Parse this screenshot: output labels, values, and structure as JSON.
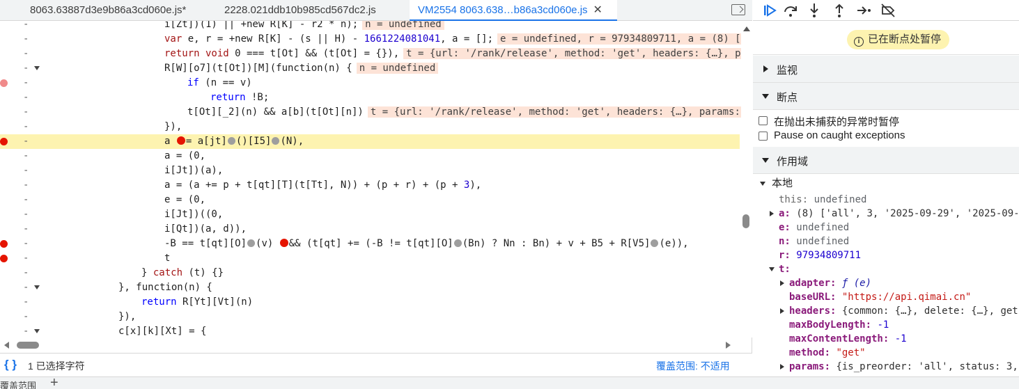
{
  "tabs": [
    {
      "label": "8063.63887d3e9b86a3cd060e.js*",
      "active": false
    },
    {
      "label": "2228.021ddb10b985cd567dc2.js",
      "active": false
    },
    {
      "label": "VM2554 8063.638…b86a3cd060e.js",
      "active": true
    }
  ],
  "code": {
    "dash": "-",
    "l1": "i[Zt])(1) || +new R[K] - r2 * n);",
    "l1_val": "n = undefined",
    "l2_kw": "var",
    "l2_a": " e, r = +new R[K] - (s || H) - ",
    "l2_num": "1661224081041",
    "l2_b": ", a = [];",
    "l2_val": "e = undefined, r = 97934809711, a = (8) ['",
    "l3_kw": "return void",
    "l3_a": " 0 === t[Ot] && (t[Ot] = {}),",
    "l3_val": "t = {url: '/rank/release', method: 'get', headers: {…}, pa",
    "l4": "R[W][o7](t[Ot])[M](function(n) {",
    "l4_val": "n = undefined",
    "l5_kw": "if",
    "l5": " (n == v)",
    "l6_kw": "return",
    "l6": " !B;",
    "l7": "t[Ot][_2](n) && a[b](t[Ot][n])",
    "l7_val": "t = {url: '/rank/release', method: 'get', headers: {…}, params:",
    "l8": "}),",
    "l9_a": "a ",
    "l9_b": "= a[jt]",
    "l9_c": "()[I5]",
    "l9_d": "(N),",
    "l10": "a = (0,",
    "l11": "i[Jt])(a),",
    "l12_a": "a = (a += p + t[qt][T](t[Tt], N)) + (p + r) + (p + ",
    "l12_num": "3",
    "l12_b": "),",
    "l13": "e = (0,",
    "l14": "i[Jt])((0,",
    "l15": "i[Qt])(a, d)),",
    "l16_a": "-B == t[qt][O]",
    "l16_b": "(v) ",
    "l16_c": "&& (t[qt] += (-B != t[qt][O]",
    "l16_d": "(Bn) ? Nn : Bn) + v + B5 + R[V5]",
    "l16_e": "(e)),",
    "l17": "t",
    "l18_a": "} ",
    "l18_kw": "catch",
    "l18_b": " (t) {}",
    "l19": "}, function(n) {",
    "l20_kw": "return",
    "l20": " R[Yt][Vt](n)",
    "l21": "}),",
    "l22": "c[x][k][Xt] = {"
  },
  "status": {
    "braces": "{ }",
    "selection": "1 已选择字符",
    "coverage": "覆盖范围: 不适用"
  },
  "bottom": {
    "label": "覆盖范围",
    "plus": "+"
  },
  "debugger": {
    "paused": "已在断点处暂停",
    "sections": {
      "watch": "监视",
      "breakpoints": "断点",
      "scope": "作用域"
    },
    "pause_uncaught": "在抛出未捕获的异常时暂停",
    "pause_caught": "Pause on caught exceptions",
    "local": "本地",
    "scope_rows": {
      "this_k": "this:",
      "this_v": "undefined",
      "a_k": "a:",
      "a_v": "(8) ['all', 3, '2025-09-29', '2025-09-2",
      "e_k": "e:",
      "e_v": "undefined",
      "n_k": "n:",
      "n_v": "undefined",
      "r_k": "r:",
      "r_v": "97934809711",
      "t_k": "t:",
      "adapter_k": "adapter:",
      "adapter_v": "ƒ (e)",
      "baseURL_k": "baseURL:",
      "baseURL_v": "\"https://api.qimai.cn\"",
      "headers_k": "headers:",
      "headers_v": "{common: {…}, delete: {…}, get:",
      "maxBody_k": "maxBodyLength:",
      "maxBody_v": "-1",
      "maxContent_k": "maxContentLength:",
      "maxContent_v": "-1",
      "method_k": "method:",
      "method_v": "\"get\"",
      "params_k": "params:",
      "params_v": "{is_preorder: 'all', status: 3,"
    }
  },
  "colors": {
    "accent": "#1a73e8",
    "breakpoint": "#e51400",
    "exec_line": "#fdf3b0",
    "inline_value_bg": "#fde3d7"
  },
  "icons": [
    "resume-icon",
    "step-over-icon",
    "step-into-icon",
    "step-out-icon",
    "step-icon",
    "deactivate-breakpoints-icon",
    "close-icon",
    "toggle-sidebar-icon",
    "info-icon"
  ]
}
